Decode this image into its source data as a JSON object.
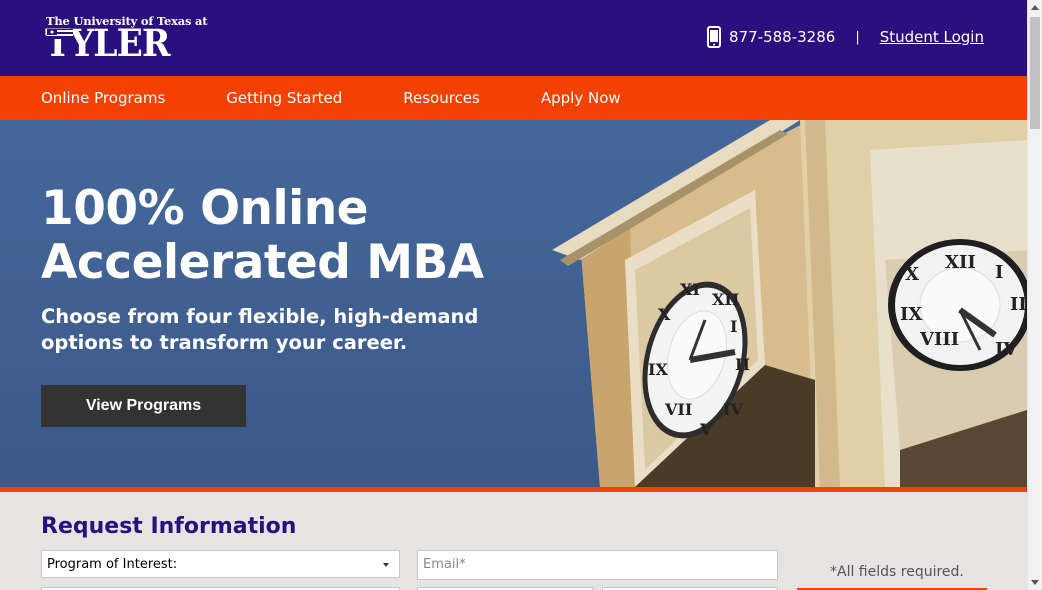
{
  "header": {
    "logo_top": "The University of Texas at",
    "logo_main": "TYLER",
    "phone": "877-588-3286",
    "separator": "|",
    "login_label": "Student Login"
  },
  "nav": {
    "items": [
      {
        "label": "Online Programs"
      },
      {
        "label": "Getting Started"
      },
      {
        "label": "Resources"
      },
      {
        "label": "Apply Now"
      }
    ]
  },
  "hero": {
    "title_line1": "100% Online",
    "title_line2": "Accelerated MBA",
    "subtitle": "Choose from four flexible, high-demand options to transform your career.",
    "button_label": "View Programs"
  },
  "form": {
    "title": "Request Information",
    "program_select_value": "Program of Interest:",
    "email_placeholder": "Email*",
    "required_note": "*All fields required."
  },
  "colors": {
    "brand_purple": "#2a0f7e",
    "brand_orange": "#f24100",
    "hero_blue": "#45679a",
    "button_dark": "#333333"
  },
  "icons": [
    "phone-icon",
    "chevron-down-icon",
    "scroll-up-icon",
    "scroll-down-icon"
  ]
}
